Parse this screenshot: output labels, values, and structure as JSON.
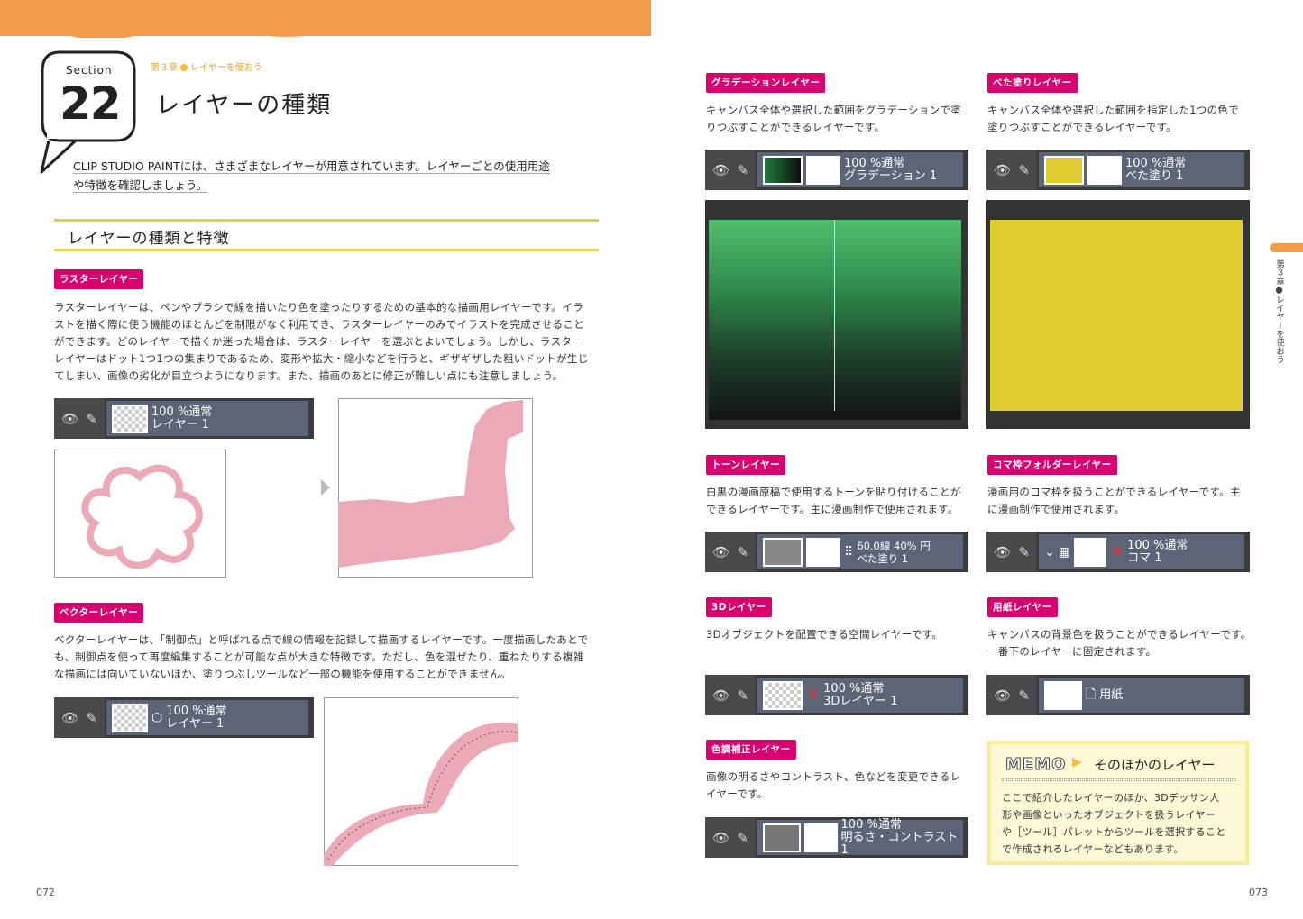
{
  "header": {
    "section_label": "Section",
    "section_number": "22",
    "breadcrumb_chapter": "第３章",
    "breadcrumb_topic": "レイヤーを使おう",
    "title": "レイヤーの種類"
  },
  "lead": {
    "line1": "CLIP STUDIO PAINTには、さまざまなレイヤーが用意されています。レイヤーごとの使用用途",
    "line2": "や特徴を確認しましょう。"
  },
  "subheading": "レイヤーの種類と特徴",
  "raster": {
    "tag": "ラスターレイヤー",
    "lines": [
      "ラスターレイヤーは、ペンやブラシで線を描いたり色を塗ったりするための基本的な描画用レイヤーです。イラ",
      "ストを描く際に使う機能のほとんどを制限がなく利用でき、ラスターレイヤーのみでイラストを完成させること",
      "ができます。どのレイヤーで描くか迷った場合は、ラスターレイヤーを選ぶとよいでしょう。しかし、ラスター",
      "レイヤーはドット1つ1つの集まりであるため、変形や拡大・縮小などを行うと、ギザギザした粗いドットが生じ",
      "てしまい、画像の劣化が目立つようになります。また、描画のあとに修正が難しい点にも注意しましょう。"
    ],
    "layer_line1": "100 %通常",
    "layer_line2": "レイヤー 1"
  },
  "vector": {
    "tag": "ベクターレイヤー",
    "lines": [
      "ベクターレイヤーは、「制御点」と呼ばれる点で線の情報を記録して描画するレイヤーです。一度描画したあとで",
      "も、制御点を使って再度編集することが可能な点が大きな特徴です。ただし、色を混ぜたり、重ねたりする複雑",
      "な描画には向いていないほか、塗りつぶしツールなど一部の機能を使用することができません。"
    ],
    "layer_line1": "100 %通常",
    "layer_line2": "レイヤー 1"
  },
  "gradation": {
    "tag": "グラデーションレイヤー",
    "lines": [
      "キャンバス全体や選択した範囲をグラデーションで塗",
      "りつぶすことができるレイヤーです。"
    ],
    "layer_line1": "100 %通常",
    "layer_line2": "グラデーション 1"
  },
  "fill": {
    "tag": "べた塗りレイヤー",
    "lines": [
      "キャンバス全体や選択した範囲を指定した1つの色で",
      "塗りつぶすことができるレイヤーです。"
    ],
    "layer_line1": "100 %通常",
    "layer_line2": "べた塗り 1"
  },
  "tone": {
    "tag": "トーンレイヤー",
    "lines": [
      "白黒の漫画原稿で使用するトーンを貼り付けることが",
      "できるレイヤーです。主に漫画制作で使用されます。"
    ],
    "layer_line1": "60.0線 40% 円",
    "layer_line2": "べた塗り 1"
  },
  "frame": {
    "tag": "コマ枠フォルダーレイヤー",
    "lines": [
      "漫画用のコマ枠を扱うことができるレイヤーです。主",
      "に漫画制作で使用されます。"
    ],
    "layer_line1": "100 %通常",
    "layer_line2": "コマ 1"
  },
  "threed": {
    "tag": "3Dレイヤー",
    "lines": [
      "3Dオブジェクトを配置できる空間レイヤーです。"
    ],
    "layer_line1": "100 %通常",
    "layer_line2": "3Dレイヤー 1"
  },
  "paper": {
    "tag": "用紙レイヤー",
    "lines": [
      "キャンバスの背景色を扱うことができるレイヤーです。",
      "一番下のレイヤーに固定されます。"
    ],
    "layer_name": "用紙"
  },
  "tonal": {
    "tag": "色調補正レイヤー",
    "lines": [
      "画像の明るさやコントラスト、色などを変更できるレ",
      "イヤーです。"
    ],
    "layer_line1": "100 %通常",
    "layer_line2": "明るさ・コントラスト 1"
  },
  "memo": {
    "label": "MEMO",
    "title": "そのほかのレイヤー",
    "lines": [
      "ここで紹介したレイヤーのほか、3Dデッサン人",
      "形や画像といったオブジェクトを扱うレイヤー",
      "や［ツール］パレットからツールを選択すること",
      "で作成されるレイヤーなどもあります。"
    ]
  },
  "side_tab": "第３章●レイヤーを使おう",
  "page_left": "072",
  "page_right": "073",
  "colors": {
    "accent_orange": "#f39a4b",
    "tag_magenta": "#d8006f",
    "heading_gold": "#e9c54a",
    "raster_pink": "#ecaab9",
    "gradient_green": "#4fbf6d",
    "fill_yellow": "#dfcd2e"
  }
}
